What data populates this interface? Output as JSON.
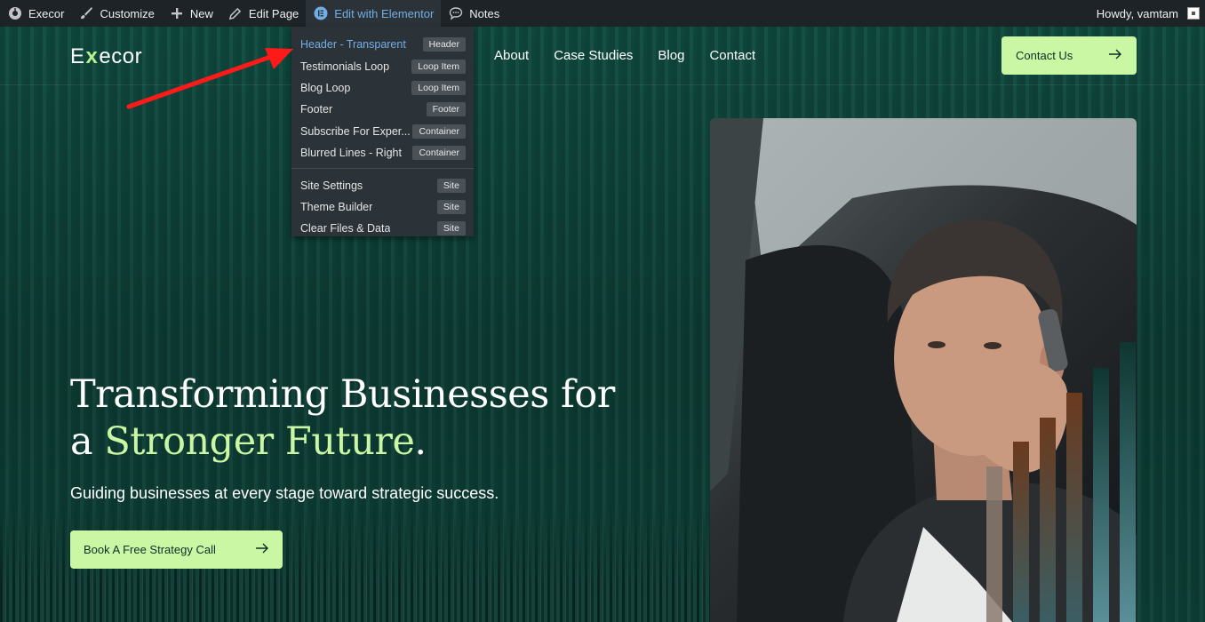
{
  "adminbar": {
    "site_name": "Execor",
    "customize": "Customize",
    "new": "New",
    "edit_page": "Edit Page",
    "edit_elementor": "Edit with Elementor",
    "notes": "Notes",
    "greeting": "Howdy, vamtam"
  },
  "dropdown": {
    "items": [
      {
        "label": "Header - Transparent",
        "badge": "Header"
      },
      {
        "label": "Testimonials Loop",
        "badge": "Loop Item"
      },
      {
        "label": "Blog Loop",
        "badge": "Loop Item"
      },
      {
        "label": "Footer",
        "badge": "Footer"
      },
      {
        "label": "Subscribe For Exper...",
        "badge": "Container"
      },
      {
        "label": "Blurred Lines - Right",
        "badge": "Container"
      },
      {
        "label": "Site Settings",
        "badge": "Site"
      },
      {
        "label": "Theme Builder",
        "badge": "Site"
      },
      {
        "label": "Clear Files & Data",
        "badge": "Site"
      }
    ]
  },
  "header": {
    "logo_pre": "E",
    "logo_x": "x",
    "logo_post": "ecor",
    "nav": [
      "About",
      "Case Studies",
      "Blog",
      "Contact"
    ],
    "cta": "Contact Us"
  },
  "hero": {
    "headline_line1": "Transforming Businesses for",
    "headline_line2_pre": "a ",
    "headline_accent": "Stronger Future",
    "headline_end": ".",
    "subline": "Guiding businesses at every stage toward strategic success.",
    "cta": "Book A Free Strategy Call"
  },
  "colors": {
    "accent": "#c9f7a4",
    "background": "#0e3c34",
    "adminbar": "#1d2327"
  }
}
